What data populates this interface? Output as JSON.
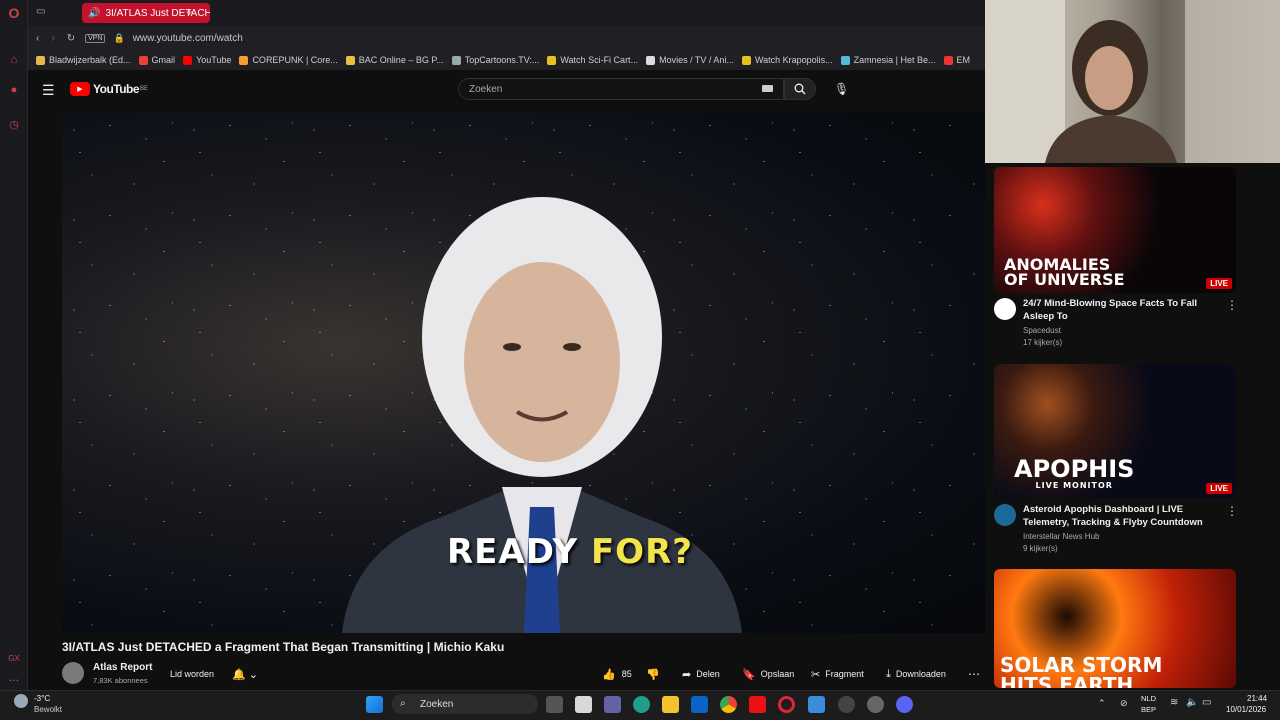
{
  "browser": {
    "active_tab_title": "3I/ATLAS Just DETACH",
    "url": "www.youtube.com/watch",
    "vpn_label": "VPN",
    "bookmarks": [
      {
        "label": "Bladwijzerbalk (Ed...",
        "icon": "folder-icon",
        "color": "#e6b84a"
      },
      {
        "label": "Gmail",
        "icon": "gmail-icon",
        "color": "#ea4335"
      },
      {
        "label": "YouTube",
        "icon": "youtube-icon",
        "color": "#ff0000"
      },
      {
        "label": "COREPUNK | Core...",
        "icon": "corepunk-icon",
        "color": "#f0a030"
      },
      {
        "label": "BAC Online – BG P...",
        "icon": "bac-icon",
        "color": "#e8c040"
      },
      {
        "label": "TopCartoons.TV:...",
        "icon": "globe-icon",
        "color": "#9aa"
      },
      {
        "label": "Watch Sci-Fi Cart...",
        "icon": "tv-icon",
        "color": "#e8c020"
      },
      {
        "label": "Movies / TV / Ani...",
        "icon": "play-icon",
        "color": "#ddd"
      },
      {
        "label": "Watch Krapopolis...",
        "icon": "tv-icon",
        "color": "#e8c020"
      },
      {
        "label": "Zamnesia | Het Be...",
        "icon": "z-icon",
        "color": "#5bd"
      },
      {
        "label": "EM",
        "icon": "em-icon",
        "color": "#e33"
      }
    ]
  },
  "youtube": {
    "logo_text": "YouTube",
    "region": "BE",
    "search_placeholder": "Zoeken"
  },
  "video": {
    "caption_white": "READY",
    "caption_yellow": "FOR?",
    "title": "3I/ATLAS Just DETACHED a Fragment That Began Transmitting | Michio Kaku",
    "channel_name": "Atlas Report",
    "subscribers": "7,83K abonnees",
    "join_label": "Lid worden",
    "likes": "85",
    "share_label": "Delen",
    "save_label": "Opslaan",
    "clip_label": "Fragment",
    "download_label": "Downloaden"
  },
  "recommendations": [
    {
      "thumb_text": [
        "ANOMALIES",
        "OF UNIVERSE"
      ],
      "title": "24/7 Mind-Blowing Space Facts To Fall Asleep To",
      "channel": "Spacedust",
      "viewers": "17 kijker(s)",
      "badge": "LIVE"
    },
    {
      "thumb_text": [
        "APOPHIS",
        "LIVE MONITOR"
      ],
      "title": "Asteroid Apophis Dashboard | LIVE Telemetry, Tracking & Flyby Countdown",
      "channel": "Interstellar News Hub",
      "viewers": "9 kijker(s)",
      "badge": "LIVE"
    },
    {
      "thumb_text": [
        "SOLAR STORM",
        "HITS EARTH"
      ],
      "title": "",
      "channel": "",
      "viewers": "",
      "badge": ""
    }
  ],
  "taskbar": {
    "weather_temp": "-3°C",
    "weather_desc": "Bewolkt",
    "search_label": "Zoeken",
    "lang_line1": "NLD",
    "lang_line2": "BEP",
    "time": "21:44",
    "date": "10/01/2026"
  },
  "sidebar": {
    "bottom_label": "GX"
  }
}
